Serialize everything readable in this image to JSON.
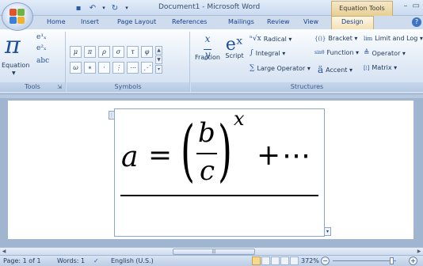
{
  "window": {
    "title": "Document1 - Microsoft Word",
    "context_tab_group": "Equation Tools",
    "minimize": "–",
    "restore": "▭"
  },
  "qat": {
    "save": "💾",
    "undo": "↶",
    "undo_drop": "▾",
    "redo": "↻",
    "customize": "▾"
  },
  "tabs": [
    {
      "label": "Home"
    },
    {
      "label": "Insert"
    },
    {
      "label": "Page Layout"
    },
    {
      "label": "References"
    },
    {
      "label": "Mailings"
    },
    {
      "label": "Review"
    },
    {
      "label": "View"
    },
    {
      "label": "Design"
    }
  ],
  "help": "?",
  "ribbon": {
    "tools": {
      "label": "Tools",
      "equation_label": "Equation",
      "equation_glyph": "π",
      "small": [
        "e¹ₓ",
        "e²ₓ",
        "abc"
      ]
    },
    "symbols": {
      "label": "Symbols",
      "row1": [
        "μ",
        "π",
        "ρ",
        "σ",
        "τ",
        "φ"
      ],
      "row2": [
        "ω",
        "∗",
        "·",
        "⋮",
        "⋯",
        "⋰"
      ]
    },
    "structures": {
      "label": "Structures",
      "fraction": {
        "label": "Fraction",
        "glyph": "x/y"
      },
      "script": {
        "label": "Script",
        "glyph": "eˣ"
      },
      "radical": {
        "label": "Radical ▾",
        "glyph": "ⁿ√x"
      },
      "integral": {
        "label": "Integral ▾",
        "glyph": "∫"
      },
      "large_operator": {
        "label": "Large Operator ▾",
        "glyph": "∑"
      },
      "bracket": {
        "label": "Bracket ▾",
        "glyph": "{()}"
      },
      "function": {
        "label": "Function ▾",
        "glyph": "sinθ"
      },
      "accent": {
        "label": "Accent ▾",
        "glyph": "ä"
      },
      "limit": {
        "label": "Limit and Log ▾",
        "glyph": "lim"
      },
      "operator": {
        "label": "Operator ▾",
        "glyph": "≜"
      },
      "matrix": {
        "label": "Matrix ▾",
        "glyph": "[⁞]"
      }
    }
  },
  "equation": {
    "lhs": "a",
    "equals": "=",
    "numerator": "b",
    "denominator": "c",
    "exponent": "x",
    "plus": "+",
    "ellipsis": "⋯",
    "left_paren": "(",
    "right_paren": ")"
  },
  "statusbar": {
    "page": "Page: 1 of 1",
    "words": "Words: 1",
    "proof": "✓",
    "language": "English (U.S.)",
    "zoom": "372%",
    "zoom_minus": "−",
    "zoom_plus": "+"
  }
}
